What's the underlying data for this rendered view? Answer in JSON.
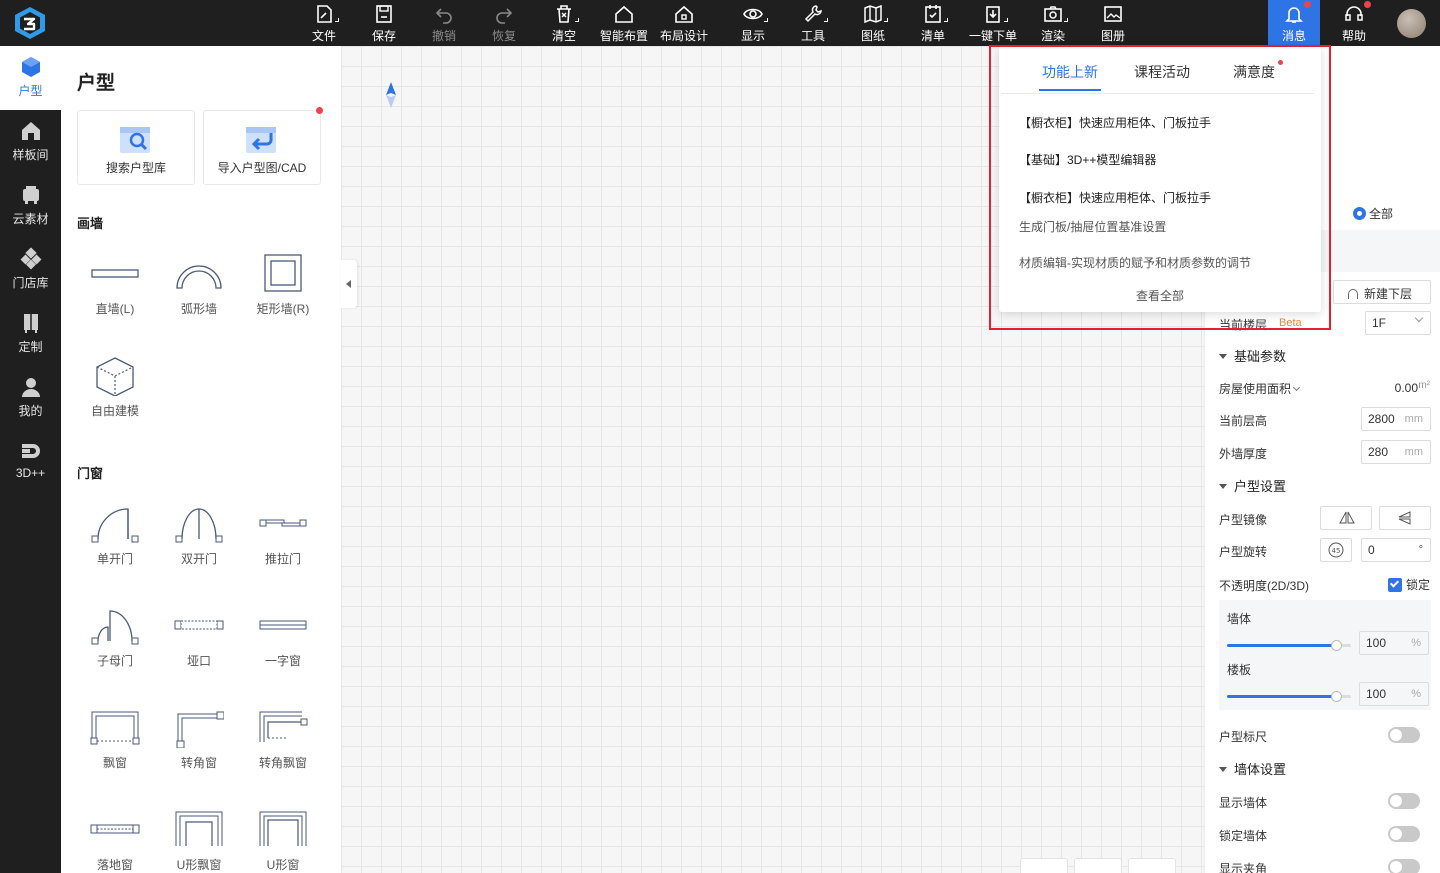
{
  "toolbar": {
    "items": [
      {
        "label": "文件",
        "icon": "file-icon"
      },
      {
        "label": "保存",
        "icon": "save-icon"
      },
      {
        "label": "撤销",
        "icon": "undo-icon"
      },
      {
        "label": "恢复",
        "icon": "redo-icon"
      },
      {
        "label": "清空",
        "icon": "clear-icon"
      },
      {
        "label": "智能布置",
        "icon": "smart-layout-icon"
      },
      {
        "label": "布局设计",
        "icon": "layout-design-icon"
      },
      {
        "label": "显示",
        "icon": "eye-icon"
      },
      {
        "label": "工具",
        "icon": "wrench-icon"
      },
      {
        "label": "图纸",
        "icon": "drawings-icon"
      },
      {
        "label": "清单",
        "icon": "checklist-icon"
      },
      {
        "label": "一键下单",
        "icon": "order-icon"
      },
      {
        "label": "渲染",
        "icon": "camera-icon"
      },
      {
        "label": "图册",
        "icon": "album-icon"
      }
    ],
    "messages_label": "消息",
    "help_label": "帮助"
  },
  "leftnav": {
    "items": [
      {
        "label": "户型",
        "icon": "floorplan-cube-icon"
      },
      {
        "label": "样板间",
        "icon": "showroom-icon"
      },
      {
        "label": "云素材",
        "icon": "cloud-material-icon"
      },
      {
        "label": "门店库",
        "icon": "store-library-icon"
      },
      {
        "label": "定制",
        "icon": "custom-cabinet-icon"
      },
      {
        "label": "我的",
        "icon": "user-icon"
      },
      {
        "label": "3D++",
        "icon": "3d-plus-icon"
      }
    ]
  },
  "catalog": {
    "title": "户型",
    "search_card": "搜索户型库",
    "import_card": "导入户型图/CAD",
    "section_wall": "画墙",
    "walls": [
      "直墙(L)",
      "弧形墙",
      "矩形墙(R)",
      "自由建模"
    ],
    "section_door": "门窗",
    "doors": [
      "单开门",
      "双开门",
      "推拉门",
      "子母门",
      "垭口",
      "一字窗",
      "飘窗",
      "转角窗",
      "转角飘窗",
      "落地窗",
      "U形飘窗",
      "U形窗"
    ]
  },
  "popup": {
    "tabs": [
      "功能上新",
      "课程活动",
      "满意度"
    ],
    "items": [
      "【橱衣柜】快速应用柜体、门板拉手",
      "【基础】3D++模型编辑器",
      "【橱衣柜】快速应用柜体、门板拉手",
      "生成门板/抽屉位置基准设置",
      "材质编辑-实现材质的赋予和材质参数的调节"
    ],
    "view_all": "查看全部"
  },
  "rpanel": {
    "all_label": "全部",
    "new_floor_label": "新建下层",
    "current_floor_label": "当前楼层",
    "beta": "Beta",
    "floor_value": "1F",
    "basic_params": "基础参数",
    "area_label": "房屋使用面积",
    "area_value": "0.00",
    "area_unit": "m²",
    "height_label": "当前层高",
    "height_value": "2800",
    "height_unit": "mm",
    "wall_thick_label": "外墙厚度",
    "wall_thick_value": "280",
    "wall_thick_unit": "mm",
    "layout_settings": "户型设置",
    "mirror_label": "户型镜像",
    "rotate_label": "户型旋转",
    "rotate_value": "0",
    "rotate_unit": "°",
    "opacity_label": "不透明度(2D/3D)",
    "lock_label": "锁定",
    "wall_label": "墙体",
    "wall_opacity": "100",
    "floor_label": "楼板",
    "floor_opacity": "100",
    "percent": "%",
    "ruler_label": "户型标尺",
    "wall_settings": "墙体设置",
    "show_wall_label": "显示墙体",
    "lock_wall_label": "锁定墙体",
    "show_angle_label": "显示夹角"
  }
}
